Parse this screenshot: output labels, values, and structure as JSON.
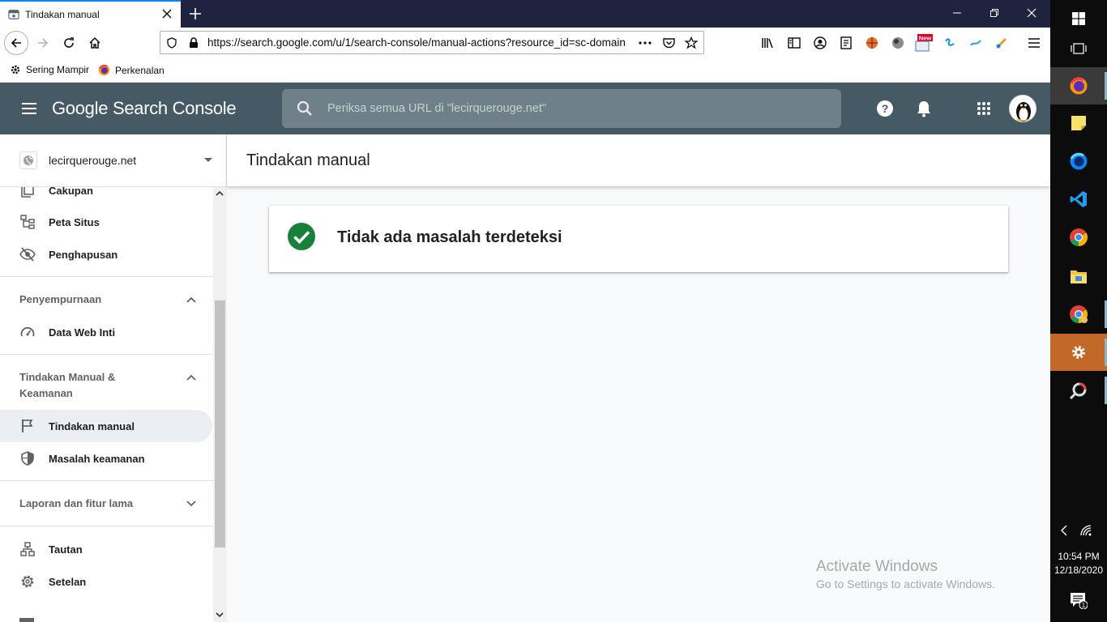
{
  "browser": {
    "tab_title": "Tindakan manual",
    "url": "https://search.google.com/u/1/search-console/manual-actions?resource_id=sc-domain",
    "bookmarks": [
      {
        "label": "Sering Mampir",
        "icon": "gear-icon"
      },
      {
        "label": "Perkenalan",
        "icon": "firefox-icon"
      }
    ],
    "new_badge": "New"
  },
  "header": {
    "app_name": "Google Search Console",
    "search_placeholder": "Periksa semua URL di \"lecirquerouge.net\""
  },
  "sidebar": {
    "property": "lecirquerouge.net",
    "items": [
      {
        "label": "Cakupan",
        "icon": "coverage-icon"
      },
      {
        "label": "Peta Situs",
        "icon": "sitemap-icon"
      },
      {
        "label": "Penghapusan",
        "icon": "removals-icon"
      }
    ],
    "sections": [
      {
        "title": "Penyempurnaan",
        "expanded": true,
        "items": [
          {
            "label": "Data Web Inti",
            "icon": "speed-icon"
          }
        ]
      },
      {
        "title_line1": "Tindakan Manual &",
        "title_line2": "Keamanan",
        "expanded": true,
        "items": [
          {
            "label": "Tindakan manual",
            "icon": "flag-icon",
            "active": true
          },
          {
            "label": "Masalah keamanan",
            "icon": "shield-icon"
          }
        ]
      },
      {
        "title": "Laporan dan fitur lama",
        "expanded": false
      }
    ],
    "bottom_items": [
      {
        "label": "Tautan",
        "icon": "links-icon"
      },
      {
        "label": "Setelan",
        "icon": "settings-icon"
      }
    ]
  },
  "main": {
    "page_title": "Tindakan manual",
    "status_message": "Tidak ada masalah terdeteksi"
  },
  "watermark": {
    "line1": "Activate Windows",
    "line2": "Go to Settings to activate Windows."
  },
  "taskbar": {
    "time": "10:54 PM",
    "date": "12/18/2020",
    "notification_count": "1"
  },
  "colors": {
    "header_bg": "#455a64",
    "success_green": "#188038",
    "tab_accent": "#0a84ff"
  }
}
